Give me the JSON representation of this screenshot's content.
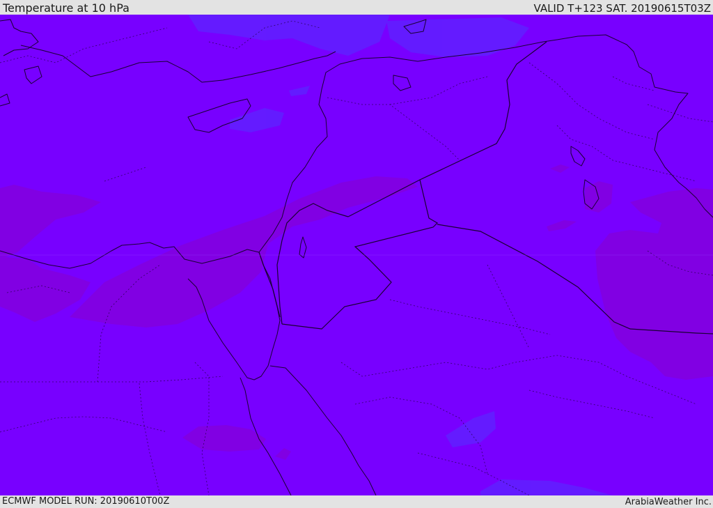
{
  "header": {
    "title": "Temperature at 10 hPa",
    "valid_time": "VALID T+123 SAT. 20190615T03Z"
  },
  "footer": {
    "model_run": "ECMWF MODEL RUN: 20190610T00Z",
    "brand": "ArabiaWeather Inc."
  },
  "colors": {
    "field_base": "#7800ff",
    "warmer_band": "#8200e0",
    "cooler_patch": "#6020ff",
    "border_line": "#1a0033",
    "header_bg": "#e3e3e3"
  }
}
